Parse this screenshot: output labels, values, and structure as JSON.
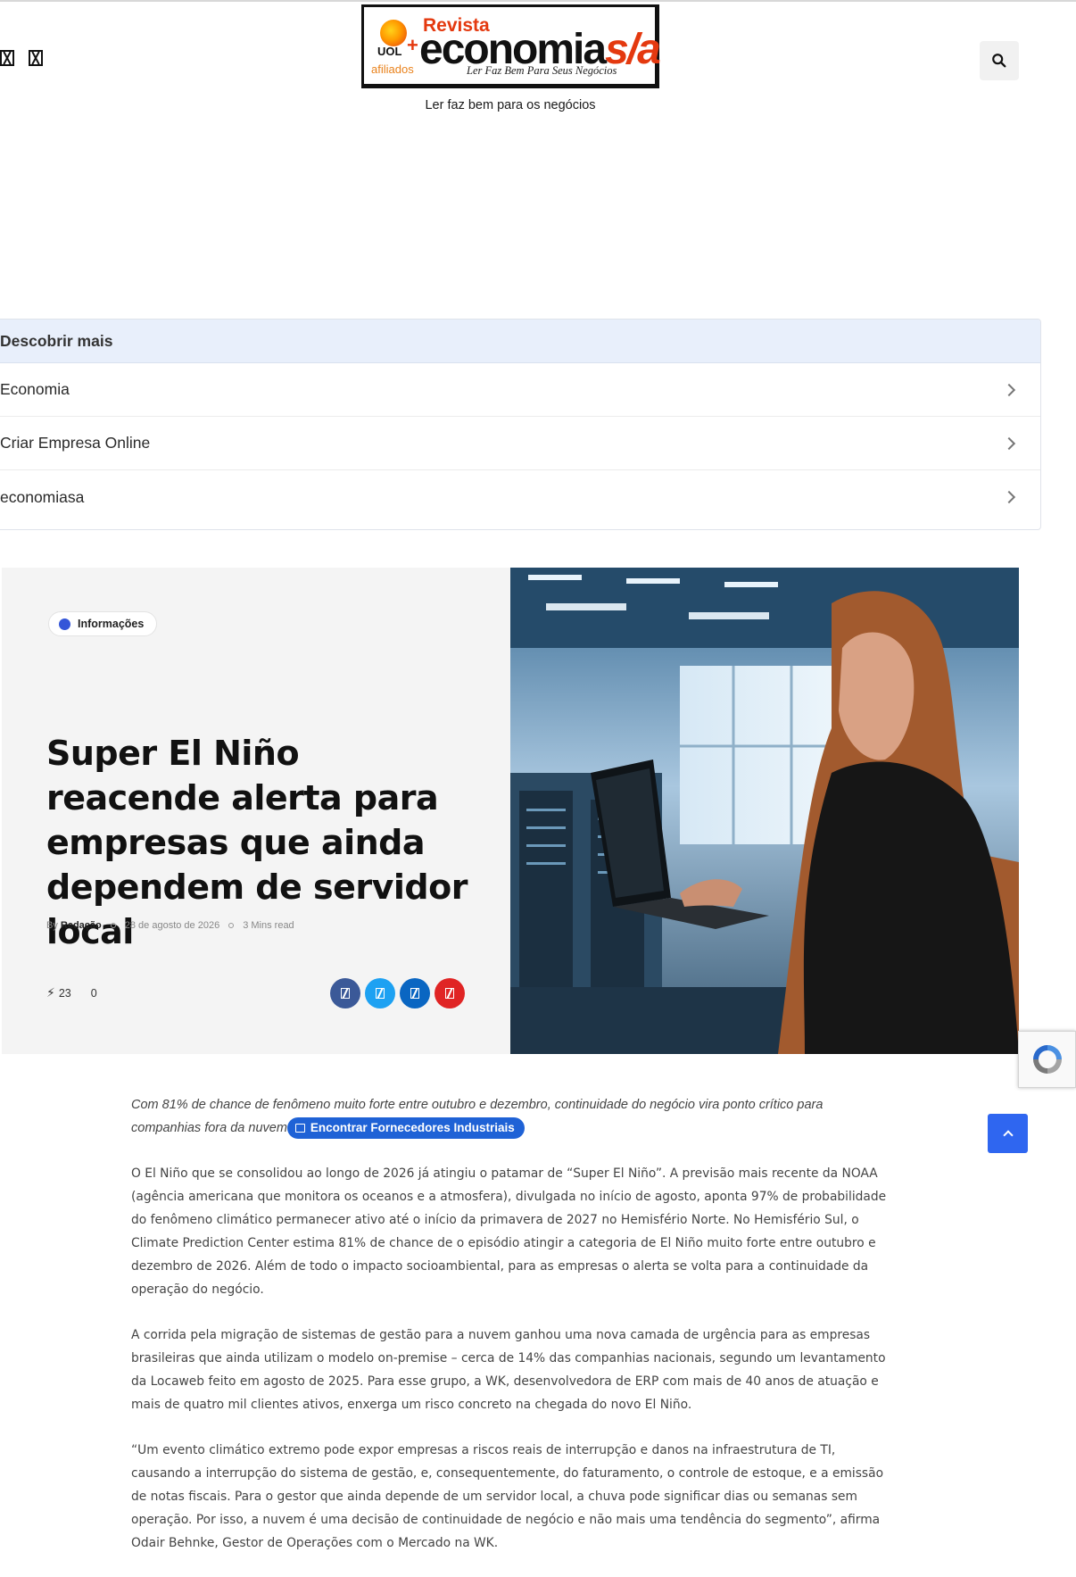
{
  "header": {
    "logo": {
      "revista": "Revista",
      "uol": "UOL",
      "plus": "+",
      "afiliados": "afiliados",
      "word_main": "economia",
      "word_suffix": "s/a",
      "tagline_script": "Ler Faz Bem Para Seus Negócios"
    },
    "tagline": "Ler faz bem para os negócios",
    "social_icons": [
      "social-icon",
      "social-icon"
    ],
    "search_icon": "search-icon"
  },
  "discover": {
    "heading": "Descobrir mais",
    "items": [
      {
        "label": "Economia"
      },
      {
        "label": "Criar Empresa Online"
      },
      {
        "label": "economiasa"
      }
    ]
  },
  "hero": {
    "category": "Informações",
    "title": "Super El Niño reacende alerta para empresas que ainda dependem de servidor local",
    "by": "By",
    "author": "Redação",
    "date": "28 de agosto de 2026",
    "read_time": "3 Mins read",
    "views": "23",
    "comments": "0",
    "share": [
      {
        "name": "facebook",
        "color": "#3b5998"
      },
      {
        "name": "twitter",
        "color": "#1da1f2"
      },
      {
        "name": "linkedin",
        "color": "#0a66c2"
      },
      {
        "name": "pinterest",
        "color": "#e02424"
      }
    ]
  },
  "article": {
    "lede": "Com 81% de chance de fenômeno muito forte entre outubro e dezembro, continuidade do negócio vira ponto crítico para companhias fora da nuvem",
    "pill": "Encontrar Fornecedores Industriais",
    "paragraphs": [
      "O El Niño que se consolidou ao longo de 2026 já atingiu o patamar de “Super El Niño”. A previsão mais recente da NOAA (agência americana que monitora os oceanos e a atmosfera), divulgada no início de agosto, aponta 97% de probabilidade do fenômeno climático permanecer ativo até o início da primavera de 2027 no Hemisfério Norte. No Hemisfério Sul, o Climate Prediction Center estima 81% de chance de o episódio atingir a categoria de El Niño muito forte entre outubro e dezembro de 2026. Além de todo o impacto socioambiental, para as empresas o alerta se volta para a continuidade da operação do negócio.",
      "A corrida pela migração de sistemas de gestão para a nuvem ganhou uma nova camada de urgência para as empresas brasileiras que ainda utilizam o modelo on-premise – cerca de 14% das companhias nacionais, segundo um levantamento da Locaweb feito em agosto de 2025. Para esse grupo, a WK, desenvolvedora de ERP com mais de 40 anos de atuação e mais de quatro mil clientes ativos, enxerga um risco concreto na chegada do novo El Niño.",
      "“Um evento climático extremo pode expor empresas a riscos reais de interrupção e danos na infraestrutura de TI, causando a interrupção do sistema de gestão, e, consequentemente, do faturamento, o controle de estoque, e a emissão de notas fiscais. Para o gestor que ainda depende de um servidor local, a chuva pode significar dias ou semanas sem operação. Por isso, a nuvem é uma decisão de continuidade de negócio e não mais uma tendência do segmento”, afirma Odair Behnke, Gestor de Operações com o Mercado na WK."
    ]
  },
  "widgets": {
    "recaptcha_icon": "recaptcha-icon",
    "back_to_top_icon": "chevron-up-icon"
  }
}
